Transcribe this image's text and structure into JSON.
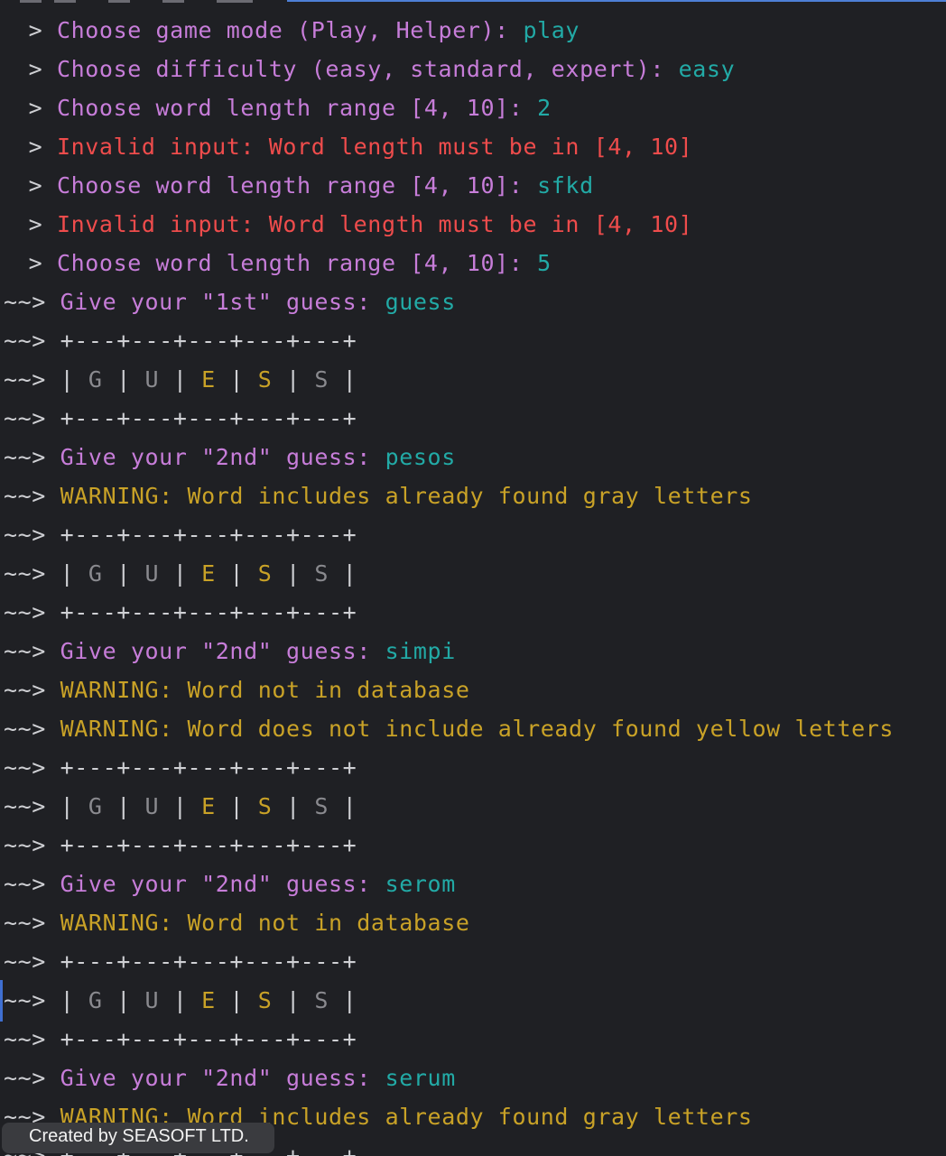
{
  "prompts": {
    "choice": " > ",
    "game": "~~> "
  },
  "lines": [
    {
      "kind": "qa",
      "question": "Choose game mode (Play, Helper): ",
      "answer": "play"
    },
    {
      "kind": "qa",
      "question": "Choose difficulty (easy, standard, expert): ",
      "answer": "easy"
    },
    {
      "kind": "qa",
      "question": "Choose word length range [4, 10]: ",
      "answer": "2"
    },
    {
      "kind": "error",
      "text": "Invalid input: Word length must be in [4, 10]"
    },
    {
      "kind": "qa",
      "question": "Choose word length range [4, 10]: ",
      "answer": "sfkd"
    },
    {
      "kind": "error",
      "text": "Invalid input: Word length must be in [4, 10]"
    },
    {
      "kind": "qa",
      "question": "Choose word length range [4, 10]: ",
      "answer": "5"
    },
    {
      "kind": "guess",
      "question": "Give your \"1st\" guess: ",
      "answer": "guess"
    },
    {
      "kind": "border",
      "text": "+---+---+---+---+---+"
    },
    {
      "kind": "board"
    },
    {
      "kind": "border",
      "text": "+---+---+---+---+---+"
    },
    {
      "kind": "guess",
      "question": "Give your \"2nd\" guess: ",
      "answer": "pesos"
    },
    {
      "kind": "warning",
      "text": "WARNING: Word includes already found gray letters"
    },
    {
      "kind": "border",
      "text": "+---+---+---+---+---+"
    },
    {
      "kind": "board"
    },
    {
      "kind": "border",
      "text": "+---+---+---+---+---+"
    },
    {
      "kind": "guess",
      "question": "Give your \"2nd\" guess: ",
      "answer": "simpi"
    },
    {
      "kind": "warning",
      "text": "WARNING: Word not in database"
    },
    {
      "kind": "warning",
      "text": "WARNING: Word does not include already found yellow letters"
    },
    {
      "kind": "border",
      "text": "+---+---+---+---+---+"
    },
    {
      "kind": "board"
    },
    {
      "kind": "border",
      "text": "+---+---+---+---+---+"
    },
    {
      "kind": "guess",
      "question": "Give your \"2nd\" guess: ",
      "answer": "serom"
    },
    {
      "kind": "warning",
      "text": "WARNING: Word not in database"
    },
    {
      "kind": "border",
      "text": "+---+---+---+---+---+"
    },
    {
      "kind": "board"
    },
    {
      "kind": "border",
      "text": "+---+---+---+---+---+"
    },
    {
      "kind": "guess",
      "question": "Give your \"2nd\" guess: ",
      "answer": "serum"
    },
    {
      "kind": "warning",
      "text": "WARNING: Word includes already found gray letters"
    },
    {
      "kind": "border",
      "text": "+---+---+---+---+---+"
    }
  ],
  "board_tiles": [
    {
      "letter": "G",
      "state": "gray"
    },
    {
      "letter": "U",
      "state": "gray"
    },
    {
      "letter": "E",
      "state": "yellow"
    },
    {
      "letter": "S",
      "state": "yellow"
    },
    {
      "letter": "S",
      "state": "gray"
    }
  ],
  "board_separator": "|",
  "watermark": "Created by SEASOFT LTD.",
  "colors": {
    "background": "#1f2024",
    "prompt": "#cfd0d4",
    "question": "#c77dd9",
    "answer": "#22aaa6",
    "error": "#ef4c4c",
    "warning": "#c9a227",
    "tile_gray": "#8a8a8f",
    "tile_yellow": "#c9a227"
  }
}
